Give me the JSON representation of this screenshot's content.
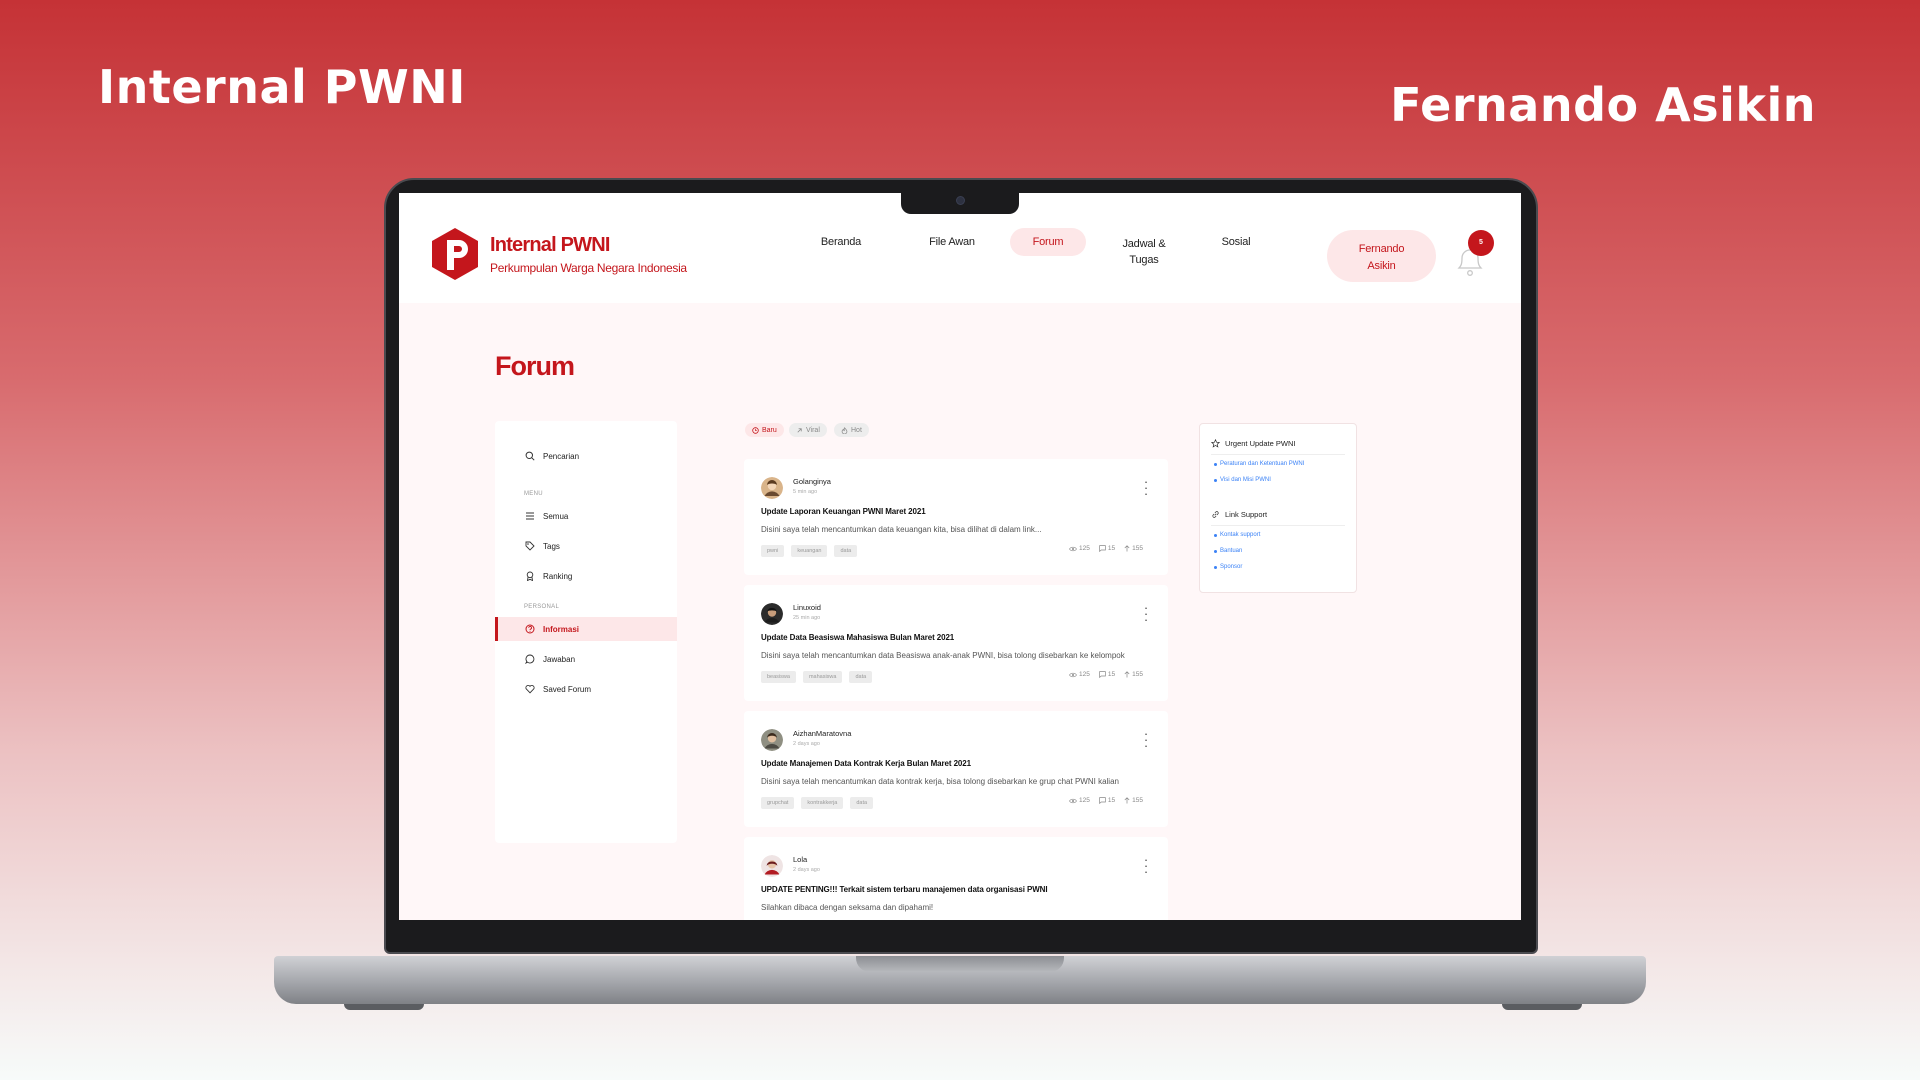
{
  "showcase": {
    "left_title": "Internal PWNI",
    "right_title": "Fernando Asikin"
  },
  "brand": {
    "name": "Internal PWNI",
    "subtitle": "Perkumpulan Warga Negara Indonesia",
    "color": "#c4161c"
  },
  "nav": {
    "items": [
      {
        "label": "Beranda"
      },
      {
        "label": "File Awan"
      },
      {
        "label": "Forum"
      },
      {
        "label": "Jadwal &",
        "label2": "Tugas"
      },
      {
        "label": "Sosial"
      }
    ],
    "active": "Forum"
  },
  "user": {
    "first_name": "Fernando",
    "last_name": "Asikin",
    "notification_count": "5"
  },
  "page": {
    "title": "Forum"
  },
  "sidebar": {
    "search_label": "Pencarian",
    "menu_heading": "MENU",
    "menu_items": [
      {
        "label": "Semua",
        "icon": "list-icon"
      },
      {
        "label": "Tags",
        "icon": "tag-icon"
      },
      {
        "label": "Ranking",
        "icon": "award-icon"
      }
    ],
    "personal_heading": "PERSONAL",
    "personal_items": [
      {
        "label": "Informasi",
        "icon": "help-circle-icon",
        "active": true
      },
      {
        "label": "Jawaban",
        "icon": "message-circle-icon"
      },
      {
        "label": "Saved Forum",
        "icon": "heart-icon"
      }
    ]
  },
  "filters": [
    {
      "label": "Baru",
      "icon": "clock-icon",
      "active": true
    },
    {
      "label": "Viral",
      "icon": "arrow-up-right-icon"
    },
    {
      "label": "Hot",
      "icon": "fire-icon"
    }
  ],
  "posts": [
    {
      "author": "Golanginya",
      "time": "5 min ago",
      "title": "Update Laporan Keuangan PWNI Maret 2021",
      "excerpt": "Disini saya telah mencantumkan data keuangan kita, bisa dilihat di dalam link...",
      "tags": [
        "pwni",
        "keuangan",
        "data"
      ],
      "views": "125",
      "comments": "15",
      "votes": "155"
    },
    {
      "author": "Linuxoid",
      "time": "25 min ago",
      "title": "Update Data Beasiswa Mahasiswa Bulan Maret 2021",
      "excerpt": "Disini saya telah mencantumkan data Beasiswa anak-anak PWNI, bisa tolong disebarkan ke kelompok",
      "tags": [
        "beasiswa",
        "mahasiswa",
        "data"
      ],
      "views": "125",
      "comments": "15",
      "votes": "155"
    },
    {
      "author": "AizhanMaratovna",
      "time": "2 days ago",
      "title": "Update Manajemen Data Kontrak Kerja Bulan Maret 2021",
      "excerpt": "Disini saya telah mencantumkan data kontrak kerja, bisa tolong disebarkan ke grup chat PWNI kalian",
      "tags": [
        "grupchat",
        "kontrakkerja",
        "data"
      ],
      "views": "125",
      "comments": "15",
      "votes": "155"
    },
    {
      "author": "Lola",
      "time": "2 days ago",
      "title": "UPDATE PENTING!!! Terkait sistem terbaru manajemen data organisasi PWNI",
      "excerpt": "Silahkan dibaca dengan seksama dan dipahami!",
      "tags": [],
      "views": "",
      "comments": "",
      "votes": ""
    }
  ],
  "right_panel": {
    "urgent_heading": "Urgent Update PWNI",
    "urgent_links": [
      "Peraturan dan Ketentuan PWNI",
      "Visi dan Misi PWNI"
    ],
    "support_heading": "Link Support",
    "support_links": [
      "Kontak support",
      "Bantuan",
      "Sponsor"
    ]
  }
}
